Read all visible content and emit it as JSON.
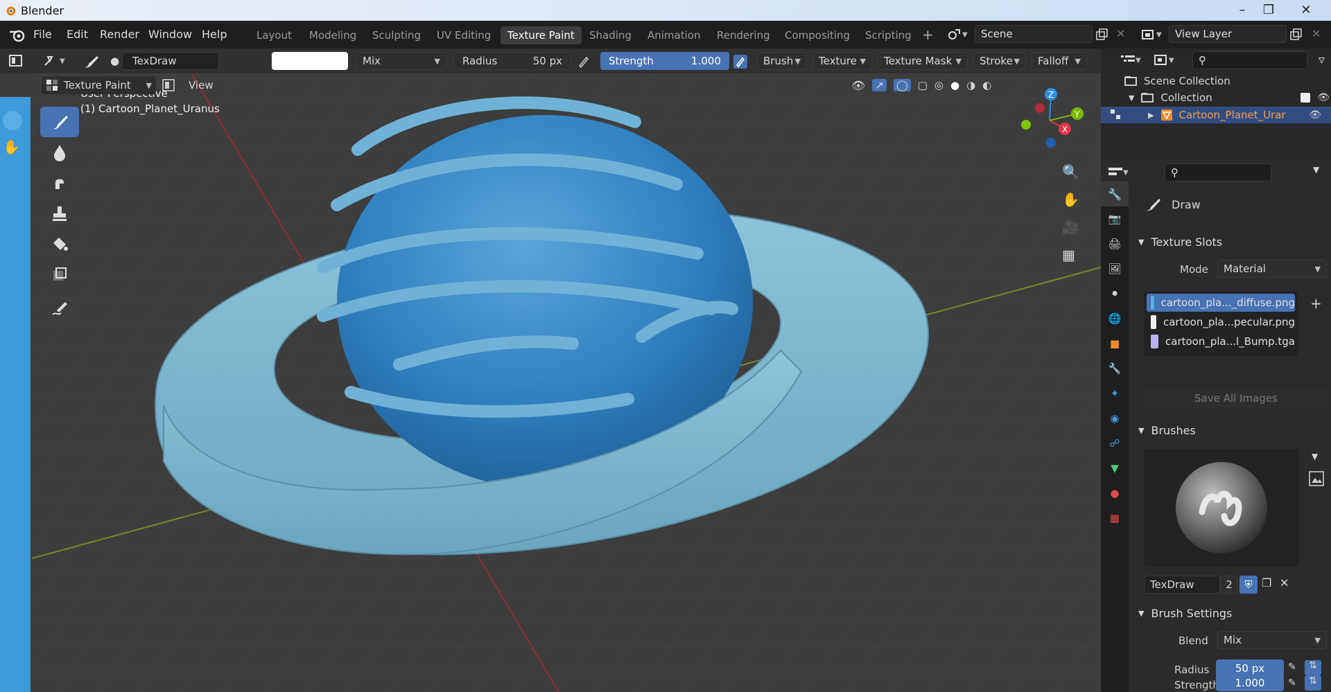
{
  "app": {
    "title": "Blender"
  },
  "menu": [
    "File",
    "Edit",
    "Render",
    "Window",
    "Help"
  ],
  "workspaces": [
    {
      "label": "Layout"
    },
    {
      "label": "Modeling"
    },
    {
      "label": "Sculpting"
    },
    {
      "label": "UV Editing"
    },
    {
      "label": "Texture Paint"
    },
    {
      "label": "Shading"
    },
    {
      "label": "Animation"
    },
    {
      "label": "Rendering"
    },
    {
      "label": "Compositing"
    },
    {
      "label": "Scripting"
    }
  ],
  "active_workspace": "Texture Paint",
  "scene": {
    "name": "Scene",
    "view_layer": "View Layer"
  },
  "tool_header": {
    "brush_name": "TexDraw",
    "blend": "Mix",
    "radius_label": "Radius",
    "radius_value": "50 px",
    "strength_label": "Strength",
    "strength_value": "1.000",
    "menus": [
      "Brush",
      "Texture",
      "Texture Mask",
      "Stroke",
      "Falloff"
    ]
  },
  "mode_header": {
    "mode": "Texture Paint",
    "view": "View"
  },
  "viewport": {
    "perspective": "User Perspective",
    "object": "(1) Cartoon_Planet_Uranus",
    "gizmo": {
      "z": "Z",
      "y": "Y",
      "x": "X"
    }
  },
  "outliner": {
    "scene_collection": "Scene Collection",
    "collection": "Collection",
    "object": "Cartoon_Planet_Urar"
  },
  "properties": {
    "active_tool": "Draw",
    "texture_slots": {
      "header": "Texture Slots",
      "mode_label": "Mode",
      "mode_value": "Material",
      "slots": [
        {
          "name": "cartoon_pla..._diffuse.png",
          "color": "#4fb3e8"
        },
        {
          "name": "cartoon_pla...pecular.png",
          "color": "#f0f0f0"
        },
        {
          "name": "cartoon_pla...l_Bump.tga",
          "color": "#b9b2f2"
        }
      ],
      "save_all": "Save All Images"
    },
    "brushes": {
      "header": "Brushes",
      "name": "TexDraw",
      "users": "2"
    },
    "brush_settings": {
      "header": "Brush Settings",
      "blend_label": "Blend",
      "blend_value": "Mix",
      "radius_label": "Radius",
      "radius_value": "50 px",
      "strength_label": "Strength",
      "strength_value": "1.000"
    }
  },
  "colors": {
    "accent": "#4772b3",
    "planet": "#3b82c4",
    "ring": "#79b4cd"
  }
}
